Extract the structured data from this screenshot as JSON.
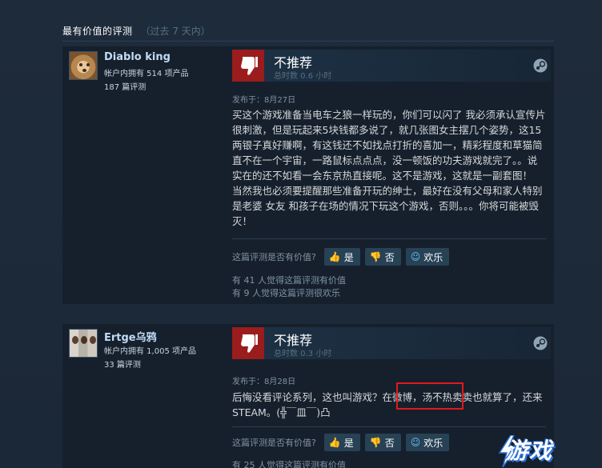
{
  "section": {
    "title": "最有价值的评测",
    "period": "（过去 7 天内）"
  },
  "reviews": [
    {
      "author_name": "Diablo king",
      "owns": "帐户内拥有 514 项产品",
      "review_count": "187 篇评测",
      "verdict": "不推荐",
      "hours": "总时数 0.6 小时",
      "posted": "发布于：8月27日",
      "text": "买这个游戏准备当电车之狼一样玩的，你们可以闪了 我必须承认宣传片很刺激，但是玩起来5块钱都多说了，就几张图女主摆几个姿势，这15两银子真好赚啊，有这钱还不如找点打折的喜加一，精彩程度和草猫简直不在一个宇宙，一路鼠标点点点，没一顿饭的功夫游戏就完了。。说实在的还不如看一会东京热直接呢。这不是游戏，这就是一副套图！\n当然我也必须要提醒那些准备开玩的绅士，最好在没有父母和家人特别是老婆 女友 和孩子在场的情况下玩这个游戏，否则。。。你将可能被毁灭！",
      "helpful_question": "这篇评测是否有价值?",
      "btn_yes": "是",
      "btn_no": "否",
      "btn_funny": "欢乐",
      "helpful_stat": "有 41 人觉得这篇评测有价值",
      "funny_stat": "有 9 人觉得这篇评测很欢乐"
    },
    {
      "author_name": "Ertge乌鸦",
      "owns": "帐户内拥有 1,005 项产品",
      "review_count": "33 篇评测",
      "verdict": "不推荐",
      "hours": "总时数 0.3 小时",
      "posted": "发布于：8月28日",
      "text": "后悔没看评论系列，这也叫游戏？在微博，汤不热卖卖也就算了，还来STEAM。(╬￣皿￣)凸",
      "helpful_question": "这篇评测是否有价值?",
      "btn_yes": "是",
      "btn_no": "否",
      "btn_funny": "欢乐",
      "helpful_stat": "有 25 人觉得这篇评测有价值"
    }
  ],
  "watermark": {
    "text": "游戏"
  },
  "colors": {
    "background": "#1b2838",
    "review_bg": "#16202d",
    "thumb_down": "#9a1c1c",
    "highlight_box": "#e2181b",
    "link_blue": "#67c1f5"
  }
}
